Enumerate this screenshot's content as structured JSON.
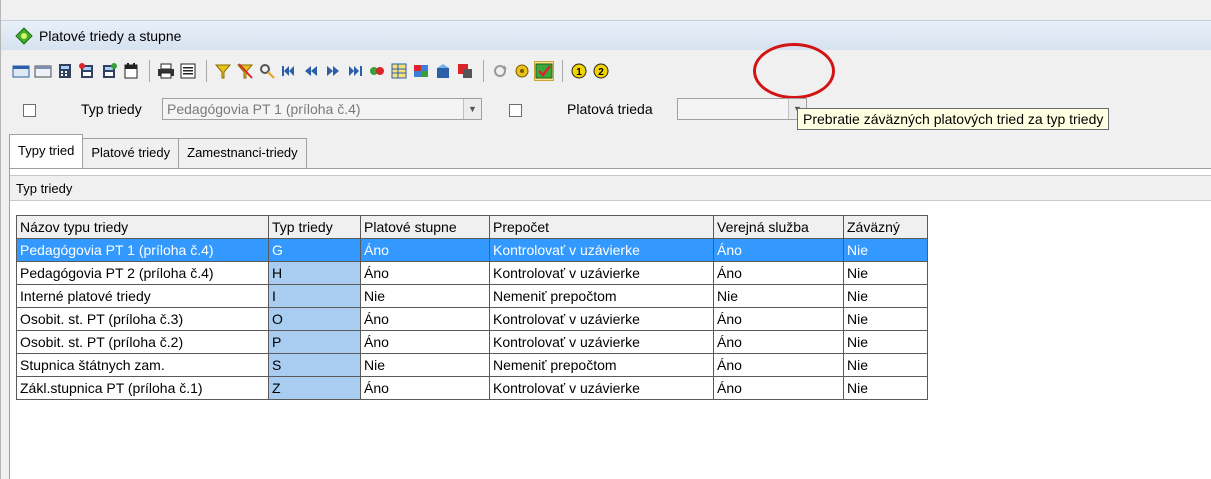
{
  "window": {
    "title": "Platové triedy a stupne"
  },
  "toolbar": {
    "icons": [
      "grid-icon",
      "grid-icon",
      "calculator-icon",
      "calculator-icon",
      "calculator-icon",
      "calendar-icon",
      "printer-icon",
      "document-icon",
      "filter-icon",
      "clear-filter-icon",
      "find-icon",
      "first-icon",
      "prev-icon",
      "next-icon",
      "last-icon",
      "link-icon",
      "table-icon",
      "transfer-icon",
      "sync-icon",
      "close-icon",
      "refresh-icon",
      "wizard-icon",
      "apply-icon",
      "info-one-icon",
      "info-two-icon"
    ]
  },
  "filters": {
    "type_label": "Typ triedy",
    "type_value": "Pedagógovia PT 1 (príloha č.4)",
    "class_label": "Platová trieda",
    "class_value": ""
  },
  "tooltip": "Prebratie záväzných platových tried za typ triedy",
  "tabs": [
    "Typy tried",
    "Platové triedy",
    "Zamestnanci-triedy"
  ],
  "panel": {
    "header": "Typ triedy"
  },
  "grid": {
    "columns": [
      "Názov typu triedy",
      "Typ triedy",
      "Platové stupne",
      "Prepočet",
      "Verejná služba",
      "Záväzný"
    ],
    "rows": [
      [
        "Pedagógovia PT 1 (príloha č.4)",
        "G",
        "Áno",
        "Kontrolovať v uzávierke",
        "Áno",
        "Nie"
      ],
      [
        "Pedagógovia PT 2 (príloha č.4)",
        "H",
        "Áno",
        "Kontrolovať v uzávierke",
        "Áno",
        "Nie"
      ],
      [
        "Interné platové triedy",
        "I",
        "Nie",
        "Nemeniť prepočtom",
        "Nie",
        "Nie"
      ],
      [
        "Osobit. st. PT (príloha č.3)",
        "O",
        "Áno",
        "Kontrolovať v uzávierke",
        "Áno",
        "Nie"
      ],
      [
        "Osobit. st. PT (príloha č.2)",
        "P",
        "Áno",
        "Kontrolovať v uzávierke",
        "Áno",
        "Nie"
      ],
      [
        "Stupnica štátnych zam.",
        "S",
        "Nie",
        "Nemeniť prepočtom",
        "Áno",
        "Nie"
      ],
      [
        "Zákl.stupnica PT (príloha č.1)",
        "Z",
        "Áno",
        "Kontrolovať v uzávierke",
        "Áno",
        "Nie"
      ]
    ],
    "selected_row": 0
  },
  "colors": {
    "selection": "#3399ff",
    "type_cell": "#a8cdf1",
    "highlight_ring": "#d21414"
  }
}
